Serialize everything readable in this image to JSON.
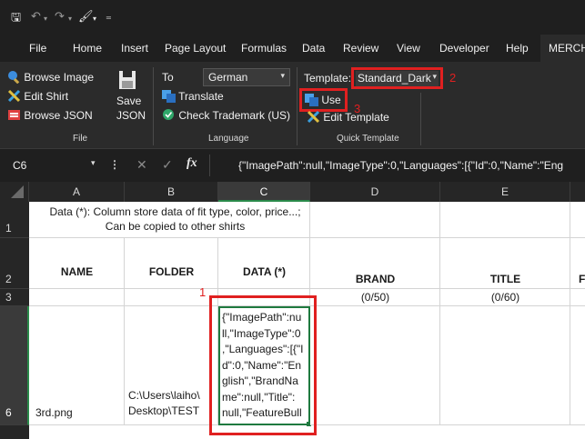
{
  "quick_access": {
    "save": "🖫",
    "undo": "↶",
    "redo": "↷",
    "brush": "🖌",
    "more": "₌"
  },
  "menu": {
    "items": [
      "File",
      "Home",
      "Insert",
      "Page Layout",
      "Formulas",
      "Data",
      "Review",
      "View",
      "Developer",
      "Help",
      "MERCH"
    ]
  },
  "ribbon": {
    "browse_image": "Browse Image",
    "edit_shirt": "Edit Shirt",
    "browse_json": "Browse JSON",
    "save_json": [
      "Save",
      "JSON"
    ],
    "file_group": "File",
    "to_label": "To",
    "language_value": "German",
    "translate": "Translate",
    "check_trademark": "Check Trademark (US)",
    "language_group": "Language",
    "template_label": "Template:",
    "template_value": "Standard_Dark",
    "use_button": "Use",
    "edit_template": "Edit Template",
    "quick_template_group": "Quick Template",
    "annotations": {
      "one": "1",
      "two": "2",
      "three": "3"
    }
  },
  "formula_bar": {
    "name_box": "C6",
    "content": "{\"ImagePath\":null,\"ImageType\":0,\"Languages\":[{\"Id\":0,\"Name\":\"Eng"
  },
  "sheet": {
    "columns": [
      "A",
      "B",
      "C",
      "D",
      "E"
    ],
    "rows": [
      "1",
      "2",
      "3",
      "6"
    ],
    "r1_note": "Data (*): Column store data of fit type, color, price...; Can be copied to other shirts",
    "headers": {
      "name": "NAME",
      "folder": "FOLDER",
      "data": "DATA (*)",
      "brand": "BRAND",
      "title": "TITLE",
      "extra": "F"
    },
    "r3": {
      "brand": "(0/50)",
      "title": "(0/60)"
    },
    "r6": {
      "name": "3rd.png",
      "folder": [
        "C:\\Users\\laiho\\",
        "Desktop\\TEST"
      ],
      "data": [
        "{\"ImagePath\":nu",
        "ll,\"ImageType\":0",
        ",\"Languages\":[{\"I",
        "d\":0,\"Name\":\"En",
        "glish\",\"BrandNa",
        "me\":null,\"Title\":",
        "null,\"FeatureBull"
      ]
    }
  }
}
